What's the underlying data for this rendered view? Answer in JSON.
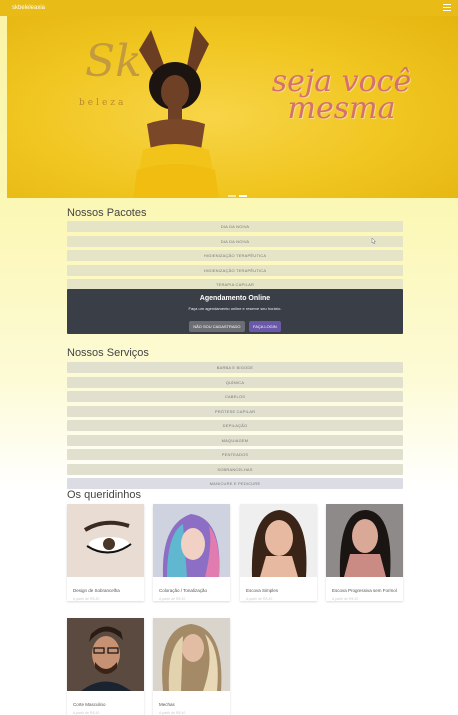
{
  "topbar": {
    "brand": "skbeleleaxia"
  },
  "hero": {
    "logo_letters": "Sk",
    "logo_sub": "beleza",
    "slogan_line1": "seja você",
    "slogan_line2": "mesma",
    "slides": 2,
    "active_slide": 2
  },
  "packages": {
    "title": "Nossos Pacotes",
    "items": [
      "DIA DA NOIVA",
      "DIA DA NOIVA",
      "HIGIENIZAÇÃO TERAPÊUTICA",
      "HIGIENIZAÇÃO TERAPÊUTICA",
      "TERAPIA CAPILAR"
    ]
  },
  "booking": {
    "title": "Agendamento Online",
    "text": "Faça um agendamento online e reserve seu horário.",
    "btn_register": "NÃO SOU CADASTRADO",
    "btn_login": "FAÇA LOGIN"
  },
  "services": {
    "title": "Nossos Serviços",
    "items": [
      "BARBA E BIGODE",
      "QUÍMICA",
      "CABELOS",
      "PRÓTESE CAPILAR",
      "DEPILAÇÃO",
      "MAQUIAGEM",
      "PENTEADOS",
      "SOBRANCELHAS",
      "MANICURE E PEDICURE"
    ]
  },
  "favorites": {
    "title": "Os queridinhos",
    "cards": [
      {
        "name": "Design de Sobrancelha",
        "price": "A partir de R$ 40"
      },
      {
        "name": "Coloração / Tonalização",
        "price": "A partir de R$ 40"
      },
      {
        "name": "Escova Simples",
        "price": "A partir de R$ 40"
      },
      {
        "name": "Escova Progressiva sem Formol",
        "price": "A partir de R$ 40"
      },
      {
        "name": "Corte Masculino",
        "price": "A partir de R$ 40"
      },
      {
        "name": "Mechas",
        "price": "A partir de R$ 40"
      }
    ]
  },
  "colors": {
    "topbar": "#e9bb17",
    "hero_bg": "#f0c51f",
    "slogan": "#d67070",
    "booking_bg": "#3a3f47",
    "login_btn": "#6a58a8"
  }
}
